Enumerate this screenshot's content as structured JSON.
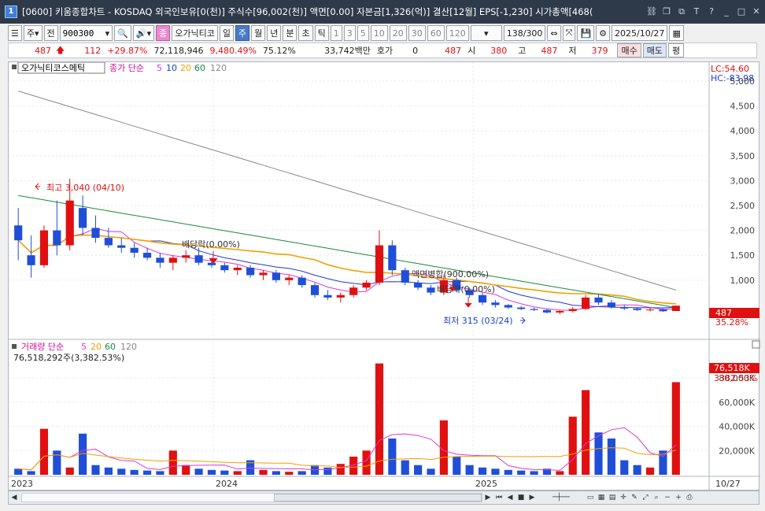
{
  "window": {
    "title": "[0600] 키움종합차트 - KOSDAQ 외국인보유[0(천)] 주식수[96,002(천)] 액면[0.00] 자본금[1,326(억)] 결산[12월] EPS[-1,230] 시가총액[468(",
    "icon": "1"
  },
  "toolbar": {
    "type_label": "주",
    "jeon_label": "전",
    "code": "900300",
    "stock_name": "오가닉티코",
    "badge": "종",
    "periods": [
      "일",
      "주",
      "월",
      "년"
    ],
    "selected_period": "주",
    "intraday": [
      "분",
      "초",
      "틱"
    ],
    "intervals": [
      "1",
      "3",
      "5",
      "10",
      "20",
      "30",
      "60",
      "120"
    ],
    "count": "138",
    "count_total": "/300",
    "date": "2025/10/27"
  },
  "quote": {
    "price": "487",
    "change": "112",
    "rate": "+29.87%",
    "volume": "72,118,946",
    "vol_rate": "9,480.49%",
    "turnover": "75.12%",
    "amount": "33,742백만",
    "hoga_label": "호가",
    "hoga": "0",
    "hoga_price": "487",
    "open_label": "시",
    "open": "380",
    "high_label": "고",
    "high": "487",
    "low_label": "저",
    "low": "379",
    "buy": "매수",
    "sell": "매도",
    "pyeong": "평"
  },
  "price_panel": {
    "name": "오가닉티코스메틱",
    "ma_label": "종가 단순",
    "ma_periods": [
      "5",
      "10",
      "20",
      "60",
      "120"
    ],
    "ma_colors": {
      "5": "#d63bd6",
      "10": "#1f3cc8",
      "20": "#f0a000",
      "60": "#1a8c3a",
      "120": "#888888"
    },
    "lc": "LC:54.60",
    "hc": "HC:-83.98",
    "current_tag": "487",
    "current_pct": "35.28%",
    "high_note": "최고 3,040 (04/10)",
    "low_note": "최저 315 (03/24)",
    "ann_dividend1": "배당락(0.00%)",
    "ann_split": "액면병합(900.00%)",
    "ann_dividend2": "배당락(0.00%)",
    "y_ticks": [
      "5,000",
      "4,500",
      "4,000",
      "3,500",
      "3,000",
      "2,500",
      "2,000",
      "1,500",
      "1,000"
    ]
  },
  "volume_panel": {
    "label": "거래량 단순",
    "ma_periods": [
      "5",
      "20",
      "60",
      "120"
    ],
    "current_text": "76,518,292주(3,382.53%)",
    "current_tag": "76,518K",
    "current_pct": "3382.53%",
    "y_ticks": [
      "80,000K",
      "60,000K",
      "40,000K",
      "20,000K"
    ]
  },
  "x_labels": [
    "2023",
    "2024",
    "2025",
    "10/27"
  ],
  "chart_data": {
    "type": "candlestick",
    "price_range": [
      0,
      5000
    ],
    "ohlc": [
      [
        2100,
        2450,
        1400,
        1800
      ],
      [
        1500,
        1900,
        1050,
        1300
      ],
      [
        1300,
        2100,
        1250,
        2000
      ],
      [
        2000,
        2600,
        1500,
        1700
      ],
      [
        1700,
        3040,
        1600,
        2600
      ],
      [
        2450,
        2700,
        1900,
        2050
      ],
      [
        2050,
        2300,
        1750,
        1850
      ],
      [
        1850,
        2050,
        1650,
        1700
      ],
      [
        1700,
        1850,
        1550,
        1650
      ],
      [
        1650,
        1750,
        1450,
        1550
      ],
      [
        1550,
        1650,
        1400,
        1450
      ],
      [
        1450,
        1550,
        1250,
        1350
      ],
      [
        1350,
        1500,
        1200,
        1450
      ],
      [
        1450,
        1600,
        1350,
        1500
      ],
      [
        1500,
        1650,
        1300,
        1350
      ],
      [
        1350,
        1450,
        1250,
        1300
      ],
      [
        1300,
        1350,
        1150,
        1200
      ],
      [
        1200,
        1300,
        1100,
        1250
      ],
      [
        1250,
        1300,
        1050,
        1100
      ],
      [
        1100,
        1200,
        1000,
        1150
      ],
      [
        1150,
        1200,
        950,
        1000
      ],
      [
        1000,
        1100,
        900,
        1050
      ],
      [
        1050,
        1100,
        850,
        900
      ],
      [
        900,
        950,
        650,
        700
      ],
      [
        700,
        800,
        600,
        650
      ],
      [
        650,
        750,
        550,
        700
      ],
      [
        700,
        900,
        650,
        850
      ],
      [
        850,
        1000,
        800,
        950
      ],
      [
        950,
        2000,
        900,
        1700
      ],
      [
        1700,
        1800,
        1100,
        1200
      ],
      [
        1200,
        1250,
        900,
        950
      ],
      [
        950,
        1000,
        800,
        850
      ],
      [
        850,
        900,
        700,
        750
      ],
      [
        750,
        1100,
        700,
        1000
      ],
      [
        1000,
        1050,
        750,
        800
      ],
      [
        800,
        850,
        650,
        700
      ],
      [
        700,
        750,
        500,
        550
      ],
      [
        550,
        600,
        450,
        500
      ],
      [
        500,
        520,
        420,
        450
      ],
      [
        450,
        480,
        400,
        420
      ],
      [
        420,
        450,
        380,
        400
      ],
      [
        400,
        430,
        330,
        350
      ],
      [
        350,
        400,
        315,
        380
      ],
      [
        380,
        460,
        350,
        420
      ],
      [
        420,
        700,
        400,
        650
      ],
      [
        650,
        720,
        500,
        550
      ],
      [
        550,
        600,
        430,
        460
      ],
      [
        460,
        500,
        400,
        430
      ],
      [
        430,
        460,
        380,
        400
      ],
      [
        400,
        440,
        370,
        410
      ],
      [
        410,
        430,
        360,
        375
      ],
      [
        380,
        487,
        379,
        487
      ]
    ],
    "volume_k": [
      5000,
      3000,
      38000,
      20000,
      6000,
      34000,
      8000,
      6000,
      5000,
      4000,
      3500,
      3000,
      20000,
      8000,
      5000,
      4000,
      3500,
      3000,
      12000,
      4000,
      3000,
      2500,
      3000,
      8000,
      6000,
      9000,
      15000,
      20000,
      92000,
      30000,
      12000,
      8000,
      5000,
      45000,
      15000,
      8000,
      6000,
      5000,
      4000,
      3500,
      3000,
      5000,
      3000,
      48000,
      70000,
      35000,
      30000,
      12000,
      8000,
      6000,
      20000,
      76518
    ]
  }
}
